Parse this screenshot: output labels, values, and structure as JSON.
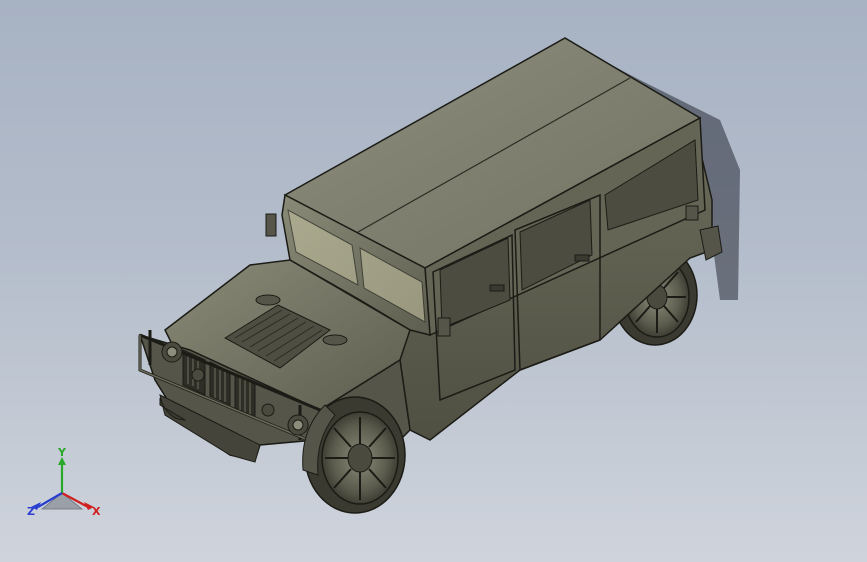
{
  "viewport": {
    "background_top": "#a7b2c3",
    "background_bottom": "#cfd4dc",
    "model_name": "",
    "model_body_color": "#6f6f60",
    "model_edge_color": "#1c1c16",
    "glass_color": "#c7c6a4"
  },
  "triad": {
    "x_label": "X",
    "y_label": "Y",
    "z_label": "Z",
    "x_color": "#d02020",
    "y_color": "#2aa82a",
    "z_color": "#2a3ed0"
  }
}
